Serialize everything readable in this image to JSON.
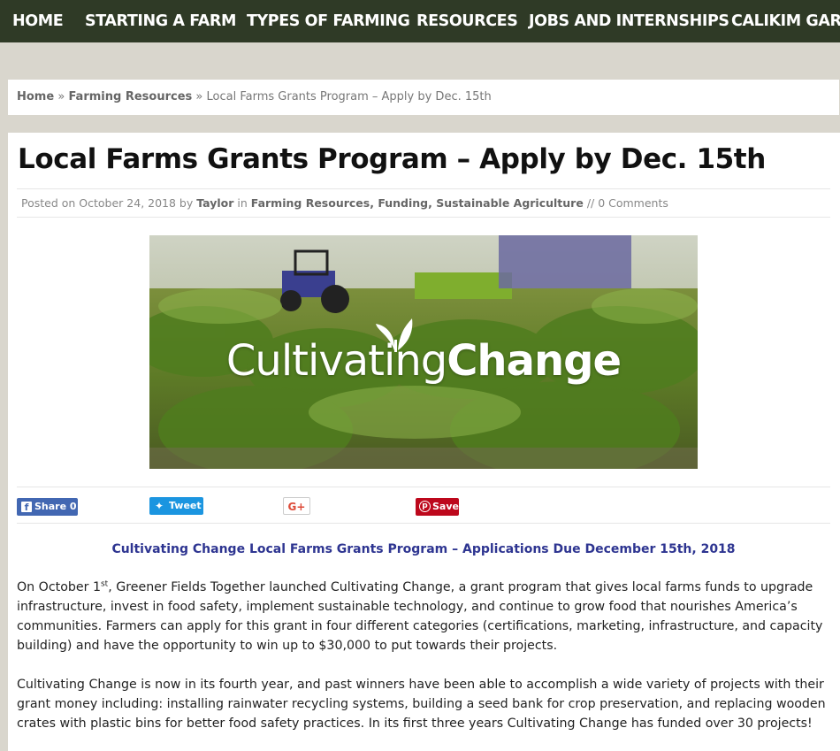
{
  "nav": {
    "items": [
      "HOME",
      "STARTING A FARM",
      "TYPES OF FARMING",
      "RESOURCES",
      "JOBS AND INTERNSHIPS",
      "CALIKIM GARD"
    ]
  },
  "breadcrumb": {
    "home": "Home",
    "sep1": "»",
    "section": "Farming Resources",
    "sep2": "»",
    "current": "Local Farms Grants Program – Apply by Dec. 15th"
  },
  "post": {
    "title": "Local Farms Grants Program – Apply by Dec. 15th",
    "meta": {
      "posted_on": "Posted on October 24, 2018 by",
      "author": "Taylor",
      "in": "in",
      "categories": "Farming Resources, Funding, Sustainable Agriculture",
      "comments": "// 0 Comments"
    },
    "hero": {
      "text_light": "Cultivating",
      "text_bold": "Change",
      "icon": "sprout-icon"
    },
    "share": {
      "facebook": "Share 0",
      "twitter": "Tweet",
      "google": "G+",
      "pinterest": "Save"
    },
    "subhead": "Cultivating Change Local Farms Grants Program – Applications Due December 15th, 2018",
    "p1_a": "On October 1",
    "p1_sup": "st",
    "p1_b": ", Greener Fields Together launched Cultivating Change, a grant program that gives local farms funds to upgrade infrastructure, invest in food safety, implement sustainable technology, and continue to grow food that nourishes America’s communities. Farmers can apply for this grant in four different categories (certifications, marketing, infrastructure, and capacity building) and have the opportunity to win up to $30,000 to put towards their projects.",
    "p2": "Cultivating Change is now in its fourth year, and past winners have been able to accomplish a wide variety of projects with their grant money including: installing rainwater recycling systems, building a seed bank for crop preservation, and replacing wooden crates with plastic bins for better food safety practices. In its first three years Cultivating Change has funded over 30 projects!"
  },
  "colors": {
    "nav_bg": "#2f3a26",
    "subhead": "#2e3591",
    "facebook": "#4267b2",
    "twitter": "#1b95e0",
    "pinterest": "#bd081c"
  }
}
